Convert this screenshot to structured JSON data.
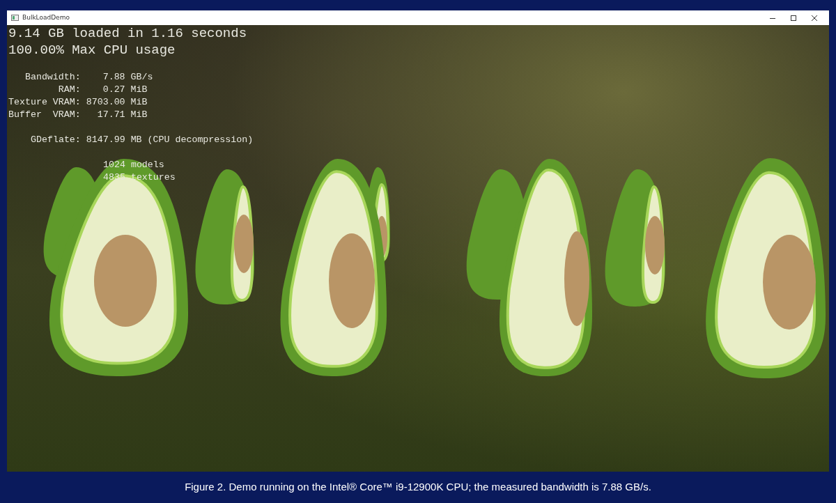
{
  "window": {
    "title": "BulkLoadDemo"
  },
  "overlay": {
    "headlines": [
      "9.14 GB loaded in 1.16 seconds",
      "100.00% Max CPU usage"
    ],
    "memory": [
      {
        "label": "Bandwidth:",
        "value": "7.88",
        "unit": "GB/s"
      },
      {
        "label": "RAM:",
        "value": "0.27",
        "unit": "MiB"
      },
      {
        "label": "Texture VRAM:",
        "value": "8703.00",
        "unit": "MiB"
      },
      {
        "label": "Buffer  VRAM:",
        "value": "17.71",
        "unit": "MiB"
      }
    ],
    "compression": "GDeflate: 8147.99 MB (CPU decompression)",
    "counts": [
      "1024 models",
      "4835 textures"
    ]
  },
  "caption": "Figure 2. Demo running on the Intel® Core™ i9-12900K CPU; the measured bandwidth is 7.88 GB/s."
}
